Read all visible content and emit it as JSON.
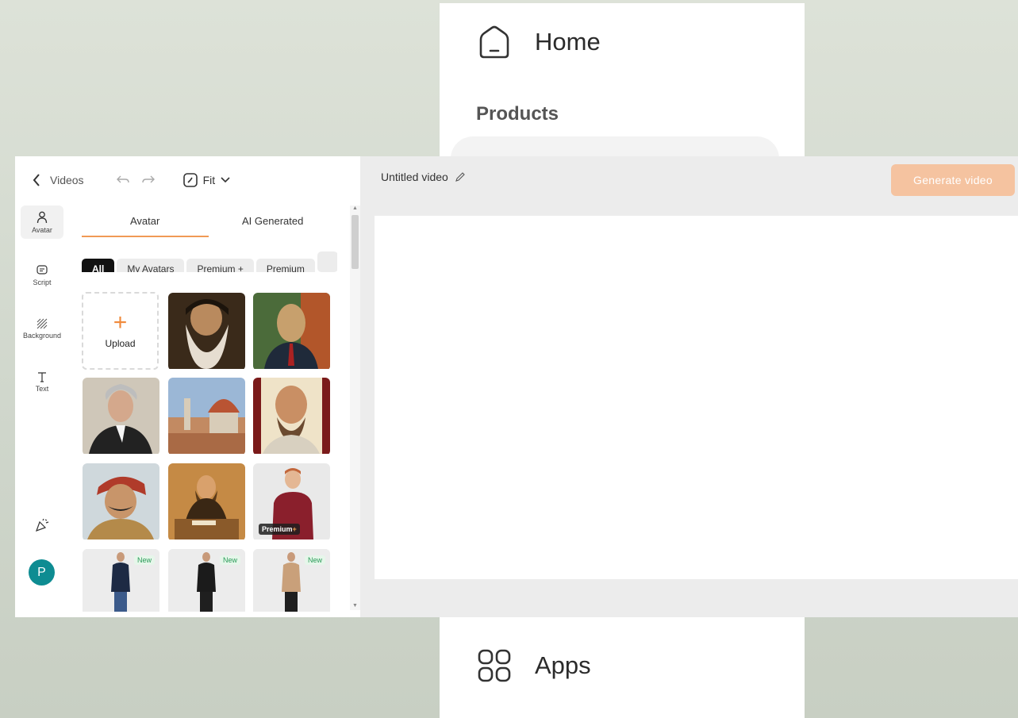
{
  "nav": {
    "home_label": "Home",
    "products_label": "Products",
    "apps_label": "Apps"
  },
  "toolbar": {
    "back_label": "Videos",
    "zoom_label": "Fit"
  },
  "rail": {
    "items": [
      {
        "label": "Avatar",
        "icon": "person-icon"
      },
      {
        "label": "Script",
        "icon": "chat-icon"
      },
      {
        "label": "Background",
        "icon": "hatch-icon"
      },
      {
        "label": "Text",
        "icon": "text-icon"
      }
    ],
    "user_initial": "P"
  },
  "tabs": [
    {
      "label": "Avatar",
      "active": true
    },
    {
      "label": "AI Generated",
      "active": false
    }
  ],
  "chips": [
    {
      "label": "All",
      "active": true
    },
    {
      "label": "My Avatars",
      "active": false
    },
    {
      "label": "Premium +",
      "active": false
    },
    {
      "label": "Premium",
      "active": false
    }
  ],
  "grid": {
    "upload_label": "Upload",
    "premium_badge": "Premium",
    "premium_badge_symbol": "+",
    "new_badge": "New"
  },
  "header": {
    "title": "Untitled video",
    "generate_label": "Generate video"
  },
  "colors": {
    "accent": "#f09a55",
    "generate_disabled": "#f5c3a0",
    "user_avatar": "#0e8c92"
  }
}
